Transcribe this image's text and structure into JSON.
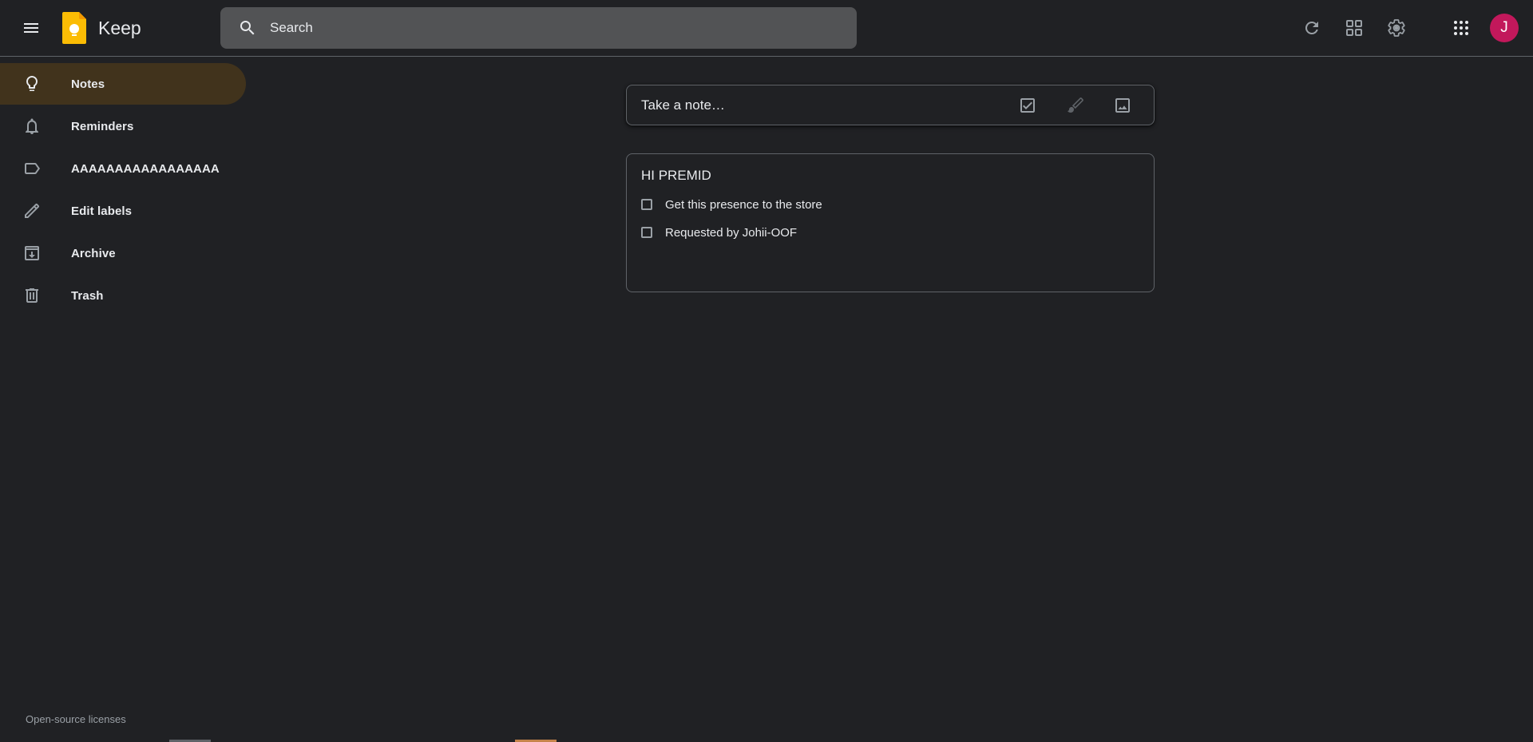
{
  "header": {
    "app_title": "Keep",
    "menu_icon": "hamburger-menu-icon",
    "logo_icon": "keep-lightbulb-logo-icon",
    "search": {
      "placeholder": "Search",
      "value": "",
      "icon": "search-icon"
    },
    "actions": [
      {
        "name": "refresh",
        "icon": "refresh-icon"
      },
      {
        "name": "list-view",
        "icon": "grid-view-icon"
      },
      {
        "name": "settings",
        "icon": "gear-icon"
      },
      {
        "name": "apps",
        "icon": "apps-grid-icon"
      }
    ],
    "avatar": {
      "initial": "J",
      "color": "#c2185b"
    }
  },
  "sidebar": {
    "items": [
      {
        "label": "Notes",
        "icon": "lightbulb-icon",
        "active": true
      },
      {
        "label": "Reminders",
        "icon": "bell-icon",
        "active": false
      },
      {
        "label": "AAAAAAAAAAAAAAAAA",
        "icon": "label-icon",
        "active": false
      },
      {
        "label": "Edit labels",
        "icon": "pencil-icon",
        "active": false
      },
      {
        "label": "Archive",
        "icon": "archive-icon",
        "active": false
      },
      {
        "label": "Trash",
        "icon": "trash-icon",
        "active": false
      }
    ],
    "footer_link": "Open-source licenses"
  },
  "take_note": {
    "placeholder": "Take a note…",
    "actions": [
      {
        "name": "new-list",
        "icon": "checkbox-icon"
      },
      {
        "name": "new-drawing",
        "icon": "brush-icon"
      },
      {
        "name": "new-image",
        "icon": "image-icon"
      }
    ]
  },
  "notes": [
    {
      "title": "HI PREMID",
      "items": [
        {
          "text": "Get this presence to the store",
          "checked": false
        },
        {
          "text": "Requested by Johii-OOF",
          "checked": false
        }
      ]
    }
  ],
  "colors": {
    "background": "#202124",
    "active_nav": "#41331c",
    "search_bg": "#525355",
    "border": "#5f6368",
    "logo_yellow": "#fbbc04"
  }
}
